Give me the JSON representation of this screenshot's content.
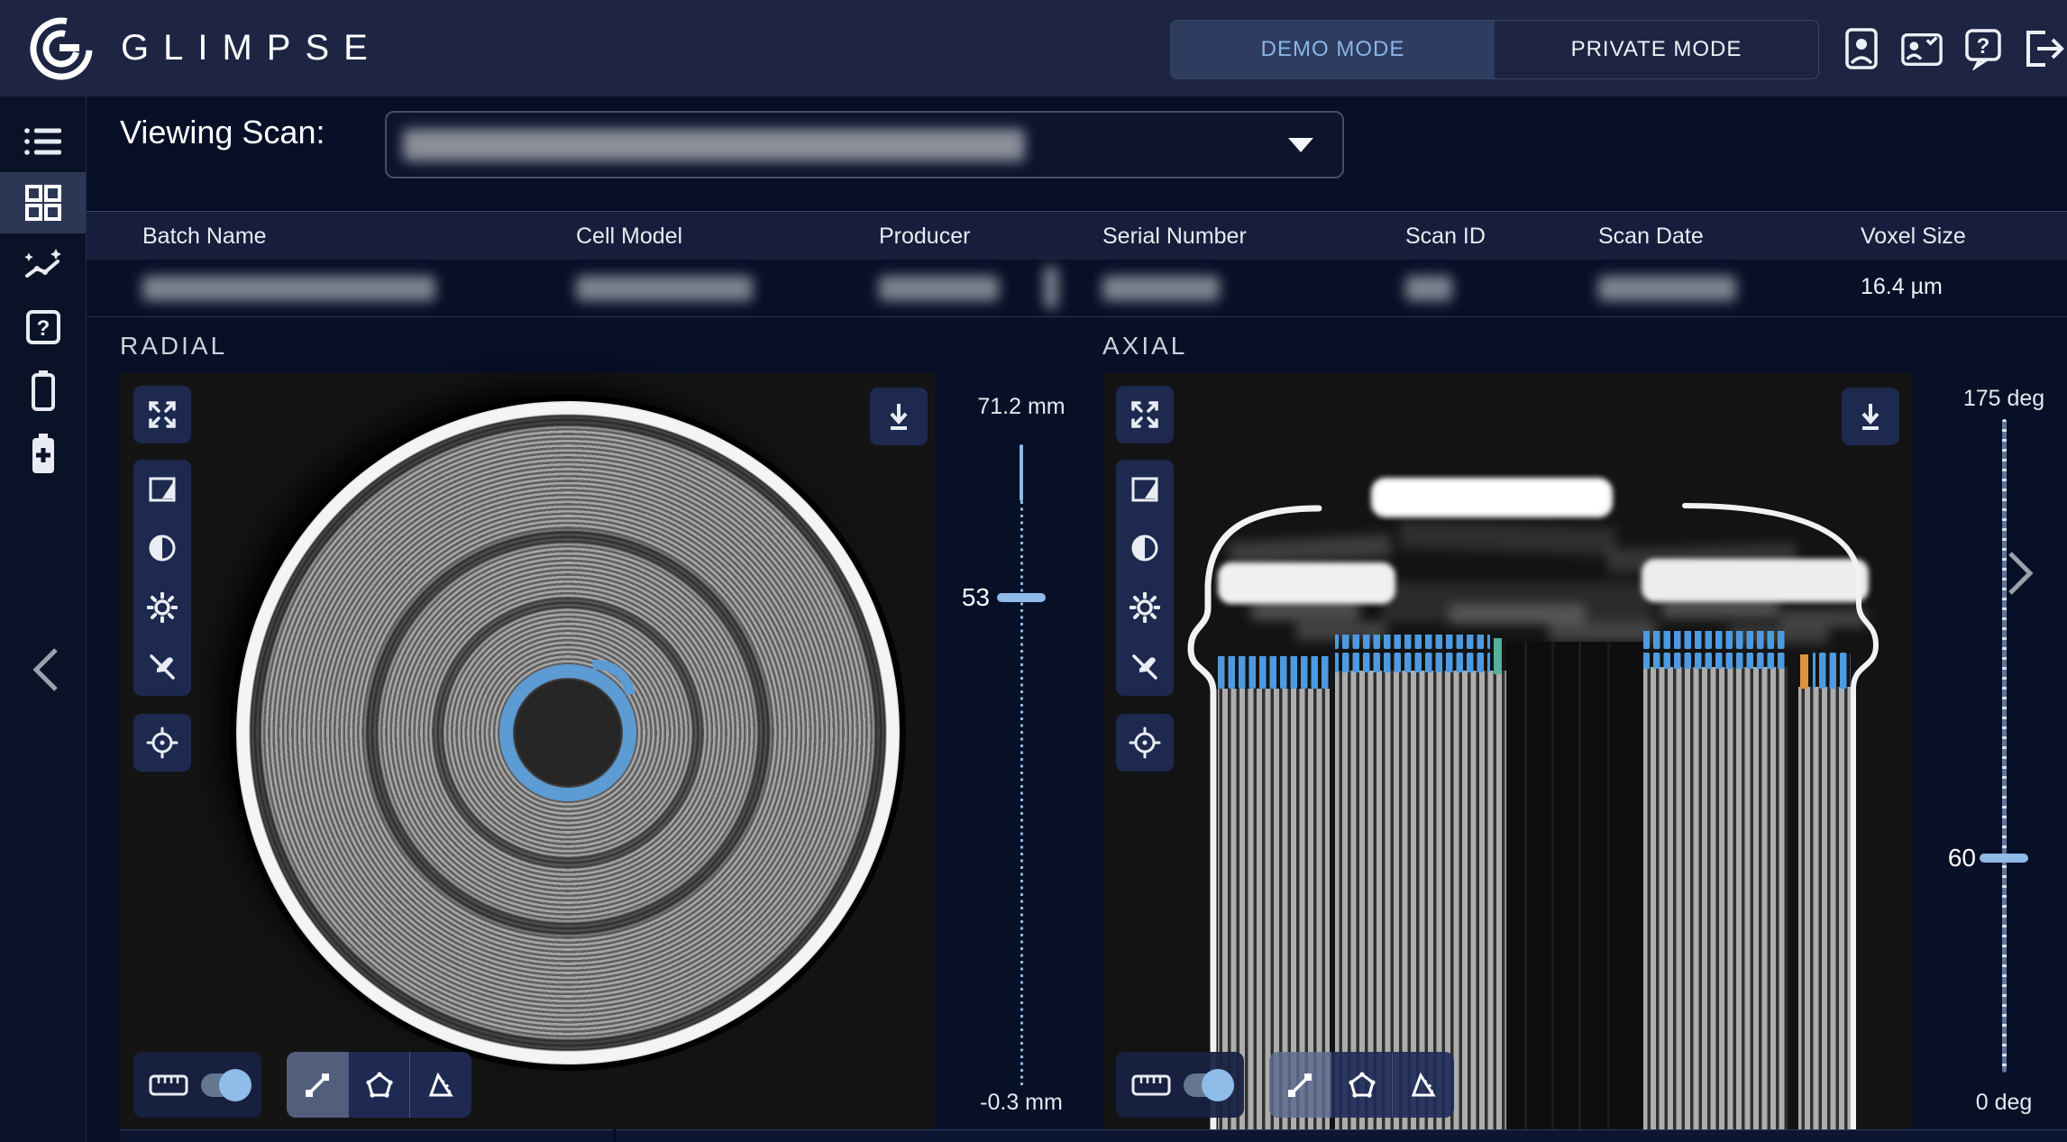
{
  "navbar": {
    "brand": "GLIMPSE",
    "demo_mode": "DEMO MODE",
    "private_mode": "PRIVATE MODE"
  },
  "viewing_scan": {
    "label": "Viewing Scan:"
  },
  "table": {
    "columns": [
      "Batch Name",
      "Cell Model",
      "Producer",
      "Serial Number",
      "Scan ID",
      "Scan Date",
      "Voxel Size"
    ],
    "row": {
      "voxel_size": "16.4 µm",
      "redacted_cells": [
        "Batch Name",
        "Cell Model",
        "Producer",
        "Serial Number",
        "Scan ID",
        "Scan Date"
      ]
    }
  },
  "panels": {
    "radial": {
      "title": "RADIAL",
      "slider": {
        "max": "71.2 mm",
        "current": "53",
        "min": "-0.3 mm"
      }
    },
    "axial": {
      "title": "AXIAL",
      "slider": {
        "max": "175 deg",
        "current": "60",
        "min": "0 deg"
      }
    }
  },
  "icons": {
    "navbar": [
      "profile-badge",
      "id-card-verified",
      "help-bubble",
      "logout"
    ],
    "sidebar": [
      "scan-list",
      "dashboard-grid",
      "analytics-trend",
      "help-box",
      "battery-empty",
      "battery-add",
      "collapse-left"
    ],
    "viewer": [
      "fullscreen",
      "flip-image",
      "contrast",
      "brightness",
      "annotations-off",
      "crosshair",
      "download",
      "ruler",
      "measure-line",
      "measure-polygon",
      "measure-angle"
    ],
    "other": [
      "dropdown-caret",
      "expand-right"
    ]
  },
  "colors": {
    "navbar_bg": "#1d2543",
    "page_bg": "#071027",
    "sidebar_bg": "#0a1228",
    "tile_bg": "#1e2950",
    "accent_blue": "#8ab5e3",
    "slider_blue": "#8fb9e6",
    "annotation_blue": "#4d9ae0",
    "annotation_orange": "#dd9440",
    "annotation_teal": "#57b099",
    "scan_bg": "#141414"
  }
}
